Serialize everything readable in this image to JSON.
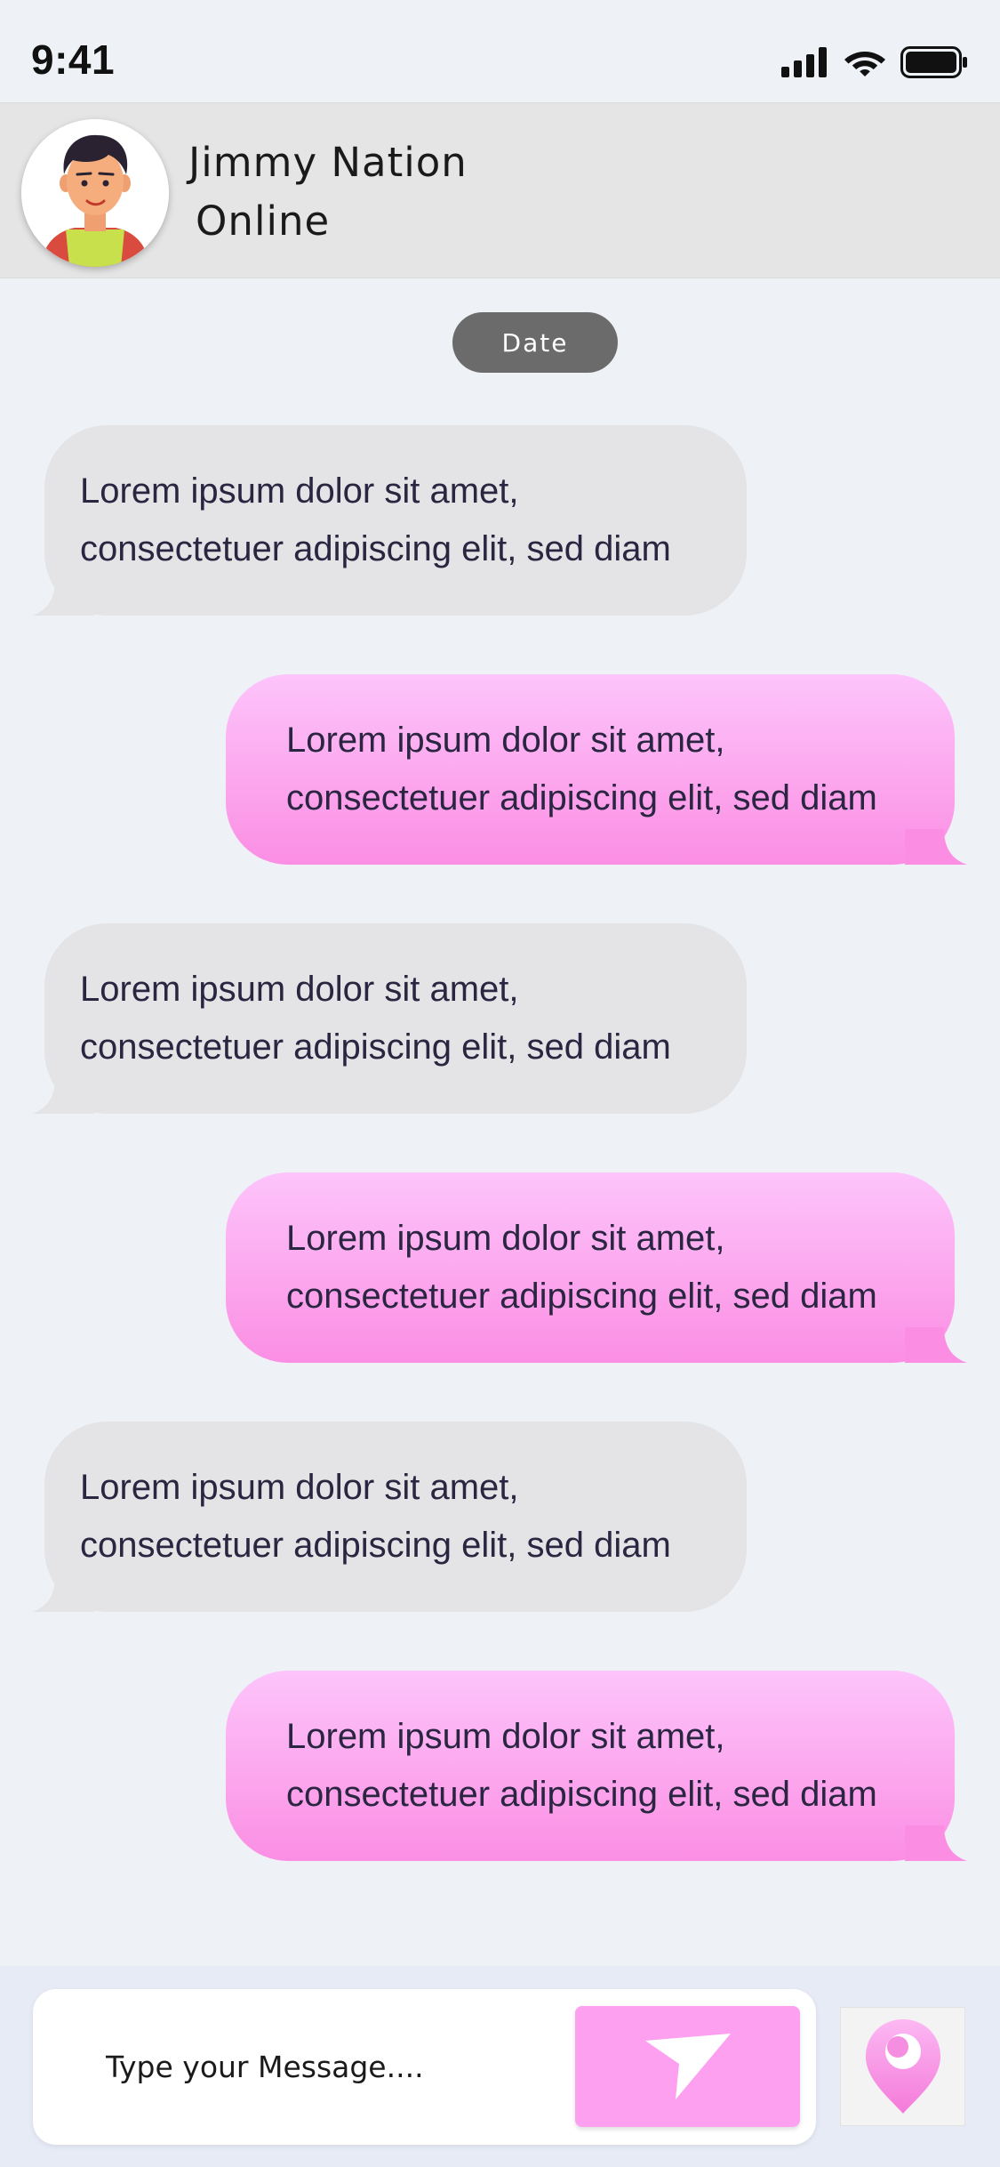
{
  "status_bar": {
    "time": "9:41",
    "icons": [
      "cellular-signal-icon",
      "wifi-icon",
      "battery-icon"
    ]
  },
  "header": {
    "contact_name": "Jimmy Nation",
    "contact_status": "Online",
    "avatar_icon": "cartoon-person-avatar"
  },
  "date_separator": "Date",
  "messages": [
    {
      "direction": "incoming",
      "text": "Lorem ipsum dolor sit amet,\nconsectetuer adipiscing elit, sed diam"
    },
    {
      "direction": "outgoing",
      "text": "Lorem ipsum dolor sit amet,\nconsectetuer adipiscing elit, sed diam"
    },
    {
      "direction": "incoming",
      "text": "Lorem ipsum dolor sit amet,\nconsectetuer adipiscing elit, sed diam"
    },
    {
      "direction": "outgoing",
      "text": "Lorem ipsum dolor sit amet,\nconsectetuer adipiscing elit, sed diam"
    },
    {
      "direction": "incoming",
      "text": "Lorem ipsum dolor sit amet,\nconsectetuer adipiscing elit, sed diam"
    },
    {
      "direction": "outgoing",
      "text": "Lorem ipsum dolor sit amet,\nconsectetuer adipiscing elit, sed diam"
    }
  ],
  "composer": {
    "placeholder": "Type your Message....",
    "value": "",
    "send_icon": "send-arrow-icon",
    "location_icon": "location-pin-icon"
  },
  "colors": {
    "background": "#eef2f6",
    "header_background": "#e5e5e5",
    "incoming_bubble": "#e4e4e6",
    "outgoing_bubble_top": "#fdc4fb",
    "outgoing_bubble_bottom": "#fb8ee3",
    "send_button": "#fda0f0",
    "date_pill": "#6b6b6b",
    "text": "#2a2540"
  }
}
